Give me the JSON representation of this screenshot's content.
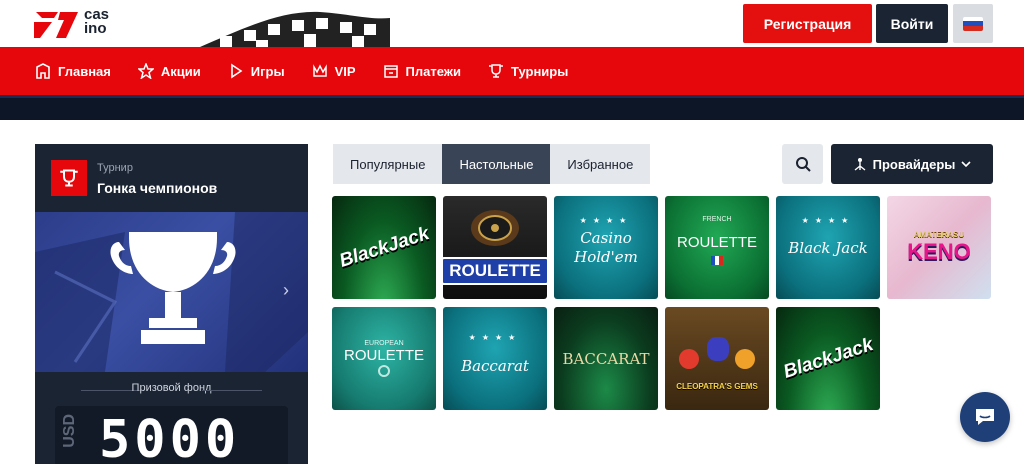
{
  "brand": {
    "logo_word": "cas\nino",
    "red": "#e5070c",
    "dark": "#1b2433"
  },
  "header": {
    "register_label": "Регистрация",
    "login_label": "Войти",
    "language": "ru-flag-icon"
  },
  "nav": {
    "items": [
      {
        "label": "Главная",
        "icon": "home-icon"
      },
      {
        "label": "Акции",
        "icon": "star-icon"
      },
      {
        "label": "Игры",
        "icon": "play-icon"
      },
      {
        "label": "VIP",
        "icon": "crown-icon"
      },
      {
        "label": "Платежи",
        "icon": "wallet-icon"
      },
      {
        "label": "Турниры",
        "icon": "trophy-icon"
      }
    ]
  },
  "tournament": {
    "label": "Турнир",
    "name": "Гонка чемпионов",
    "prize_label": "Призовой фонд",
    "currency": "USD",
    "amount": "5000"
  },
  "games_tabs": {
    "tabs": [
      {
        "label": "Популярные",
        "active": false
      },
      {
        "label": "Настольные",
        "active": true
      },
      {
        "label": "Избранное",
        "active": false
      }
    ],
    "providers_label": "Провайдеры"
  },
  "games": [
    {
      "title": "BlackJack"
    },
    {
      "title": "ROULETTE"
    },
    {
      "title": "Casino Hold'em"
    },
    {
      "title": "ROULETTE",
      "sub": "FRENCH"
    },
    {
      "title": "Black Jack"
    },
    {
      "title": "KENO",
      "sub": "AMATERASU"
    },
    {
      "title": "ROULETTE",
      "sub": "EUROPEAN"
    },
    {
      "title": "Baccarat"
    },
    {
      "title": "BACCARAT"
    },
    {
      "title": "CLEOPATRA'S GEMS"
    },
    {
      "title": "BlackJack"
    }
  ]
}
